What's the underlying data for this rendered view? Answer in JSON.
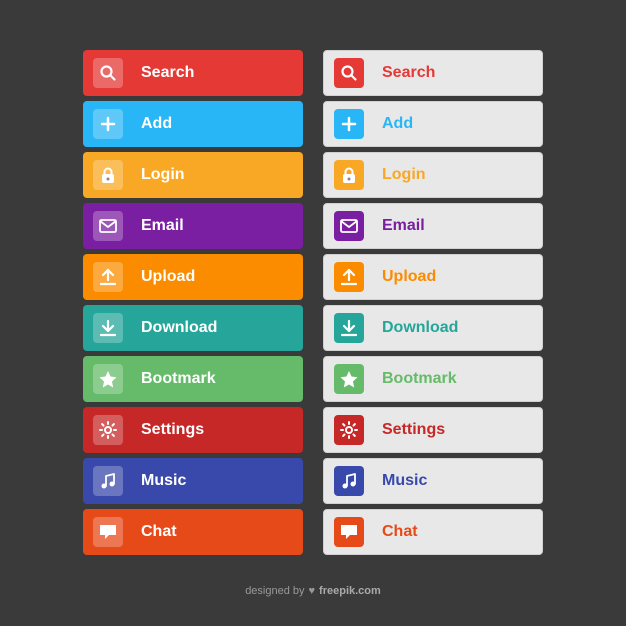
{
  "buttons": [
    {
      "id": "search",
      "label": "Search",
      "colorClass": "bg-red",
      "textClass": "text-red",
      "iconClass": "icon-red",
      "iconType": "search"
    },
    {
      "id": "add",
      "label": "Add",
      "colorClass": "bg-blue",
      "textClass": "text-blue",
      "iconClass": "icon-blue",
      "iconType": "plus"
    },
    {
      "id": "login",
      "label": "Login",
      "colorClass": "bg-yellow",
      "textClass": "text-yellow",
      "iconClass": "icon-yellow",
      "iconType": "lock"
    },
    {
      "id": "email",
      "label": "Email",
      "colorClass": "bg-purple",
      "textClass": "text-purple",
      "iconClass": "icon-purple",
      "iconType": "email"
    },
    {
      "id": "upload",
      "label": "Upload",
      "colorClass": "bg-orange",
      "textClass": "text-orange",
      "iconClass": "icon-orange",
      "iconType": "upload"
    },
    {
      "id": "download",
      "label": "Download",
      "colorClass": "bg-teal",
      "textClass": "text-teal",
      "iconClass": "icon-teal",
      "iconType": "download"
    },
    {
      "id": "bookmark",
      "label": "Bootmark",
      "colorClass": "bg-green",
      "textClass": "text-green",
      "iconClass": "icon-green",
      "iconType": "star"
    },
    {
      "id": "settings",
      "label": "Settings",
      "colorClass": "bg-darkred",
      "textClass": "text-darkred",
      "iconClass": "icon-darkred",
      "iconType": "gear"
    },
    {
      "id": "music",
      "label": "Music",
      "colorClass": "bg-indigo",
      "textClass": "text-indigo",
      "iconClass": "icon-indigo",
      "iconType": "music"
    },
    {
      "id": "chat",
      "label": "Chat",
      "colorClass": "bg-darkorange",
      "textClass": "text-darkorange",
      "iconClass": "icon-darkorange",
      "iconType": "chat"
    }
  ],
  "footer": {
    "text": "designed by",
    "brand": "freepik.com"
  }
}
